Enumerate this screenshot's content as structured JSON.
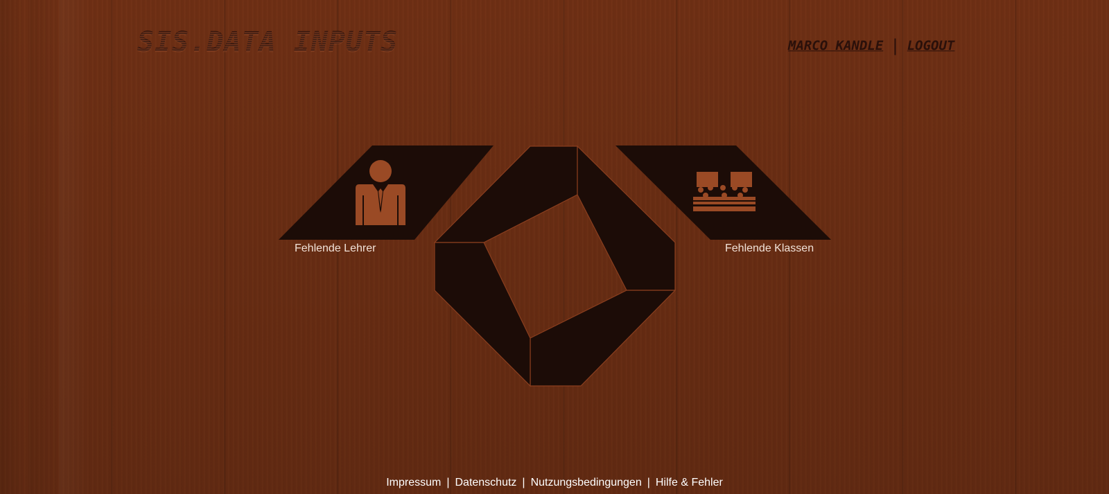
{
  "header": {
    "brand": "SIS.DATA INPUTS",
    "user_name": "MARCO KANDLE",
    "separator": "|",
    "logout_label": "LOGOUT"
  },
  "tiles": {
    "teachers": {
      "label": "Fehlende Lehrer",
      "icon": "teacher-icon"
    },
    "classes": {
      "label": "Fehlende Klassen",
      "icon": "classroom-icon"
    }
  },
  "center_logo": {
    "icon": "geometric-diamond-logo"
  },
  "footer": {
    "links": [
      "Impressum",
      "Datenschutz",
      "Nutzungsbedingungen",
      "Hilfe & Fehler"
    ],
    "separator": "|"
  },
  "colors": {
    "wood": "#6e2f14",
    "tile_fill": "#1c0c07",
    "tile_edge": "#8a3e1e",
    "icon_fill": "#9a4a25",
    "label_text": "#f1e2d8"
  }
}
